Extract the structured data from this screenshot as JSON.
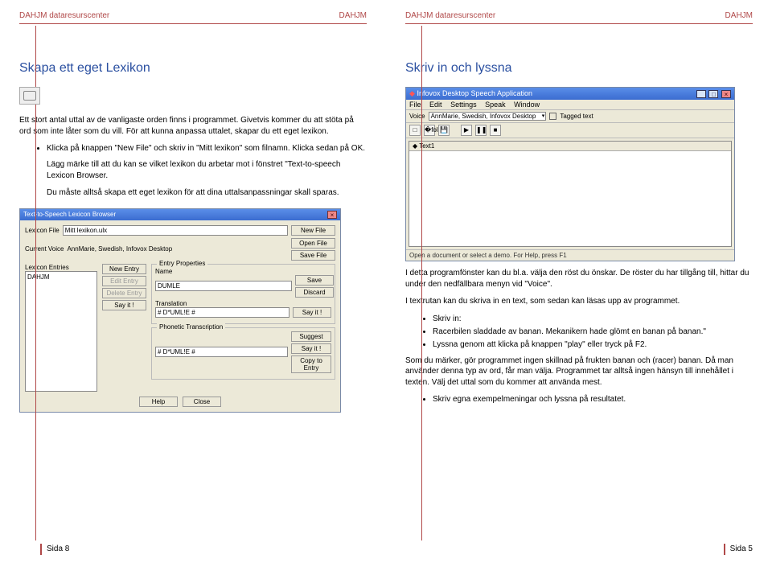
{
  "doc": {
    "header_left": "DAHJM dataresurscenter",
    "header_right": "DAHJM"
  },
  "left_page": {
    "title": "Skapa ett eget Lexikon",
    "intro": "Ett stort antal uttal av de vanligaste orden finns i programmet. Givetvis kommer du att stöta på ord som inte låter som du vill. För att kunna anpassa uttalet, skapar du ett eget lexikon.",
    "b1": "Klicka på knappen \"New File\" och skriv in \"Mitt lexikon\" som filnamn. Klicka sedan på OK.",
    "note1": "Lägg märke till att du kan se vilket lexikon du arbetar mot i fönstret \"Text-to-speech Lexicon Browser.",
    "note2": "Du måste alltså skapa ett eget lexikon för att dina uttalsanpassningar skall sparas.",
    "footer": "Sida 8"
  },
  "right_page": {
    "title": "Skriv in och lyssna",
    "p1": "I detta programfönster kan du bl.a. välja den röst du önskar. De röster du har tillgång till, hittar du under den nedfällbara menyn vid \"Voice\".",
    "p2": "I textrutan kan du skriva in en text, som sedan kan läsas upp av programmet.",
    "b1": "Skriv in:",
    "b2": "Racerbilen sladdade av banan. Mekanikern hade glömt en banan på banan.\"",
    "b3": "Lyssna genom att klicka på knappen \"play\" eller tryck på F2.",
    "p3": "Som du märker, gör programmet ingen skillnad på frukten banan och (racer) banan. Då man använder denna typ av ord, får man välja. Programmet tar alltså ingen hänsyn till innehållet i texten. Välj det uttal som du kommer att använda mest.",
    "b4": "Skriv egna exempelmeningar och lyssna på resultatet.",
    "footer": "Sida 5"
  },
  "app_win": {
    "title": "Infovox Desktop Speech Application",
    "menus": [
      "File",
      "Edit",
      "Settings",
      "Speak",
      "Window"
    ],
    "voice_label": "Voice",
    "voice_value": "AnnMarie, Swedish, Infovox Desktop",
    "tagged": "Tagged text",
    "tab": "Text1",
    "status": "Open a document or select a demo. For Help, press F1"
  },
  "lex_win": {
    "title": "Text-to-Speech Lexicon Browser",
    "lexicon_file_label": "Lexicon File",
    "lexicon_file_value": "Mitt lexikon.ulx",
    "current_voice_label": "Current Voice",
    "current_voice_value": "AnnMarie, Swedish, Infovox Desktop",
    "new_file": "New File",
    "open_file": "Open File",
    "save_file": "Save File",
    "entries_label": "Lexicon Entries",
    "entry_item": "DAHJM",
    "new_entry": "New Entry",
    "edit_entry": "Edit Entry",
    "delete_entry": "Delete Entry",
    "say_it": "Say it !",
    "props_label": "Entry Properties",
    "name_label": "Name",
    "name_value": "DUMLE",
    "save": "Save",
    "discard": "Discard",
    "translation_label": "Translation",
    "translation_value": "# D*UML!E #",
    "phon_label": "Phonetic Transcription",
    "phon_value": "# D*UML!E #",
    "suggest": "Suggest",
    "copy_to_entry": "Copy to Entry",
    "help": "Help",
    "close": "Close"
  }
}
